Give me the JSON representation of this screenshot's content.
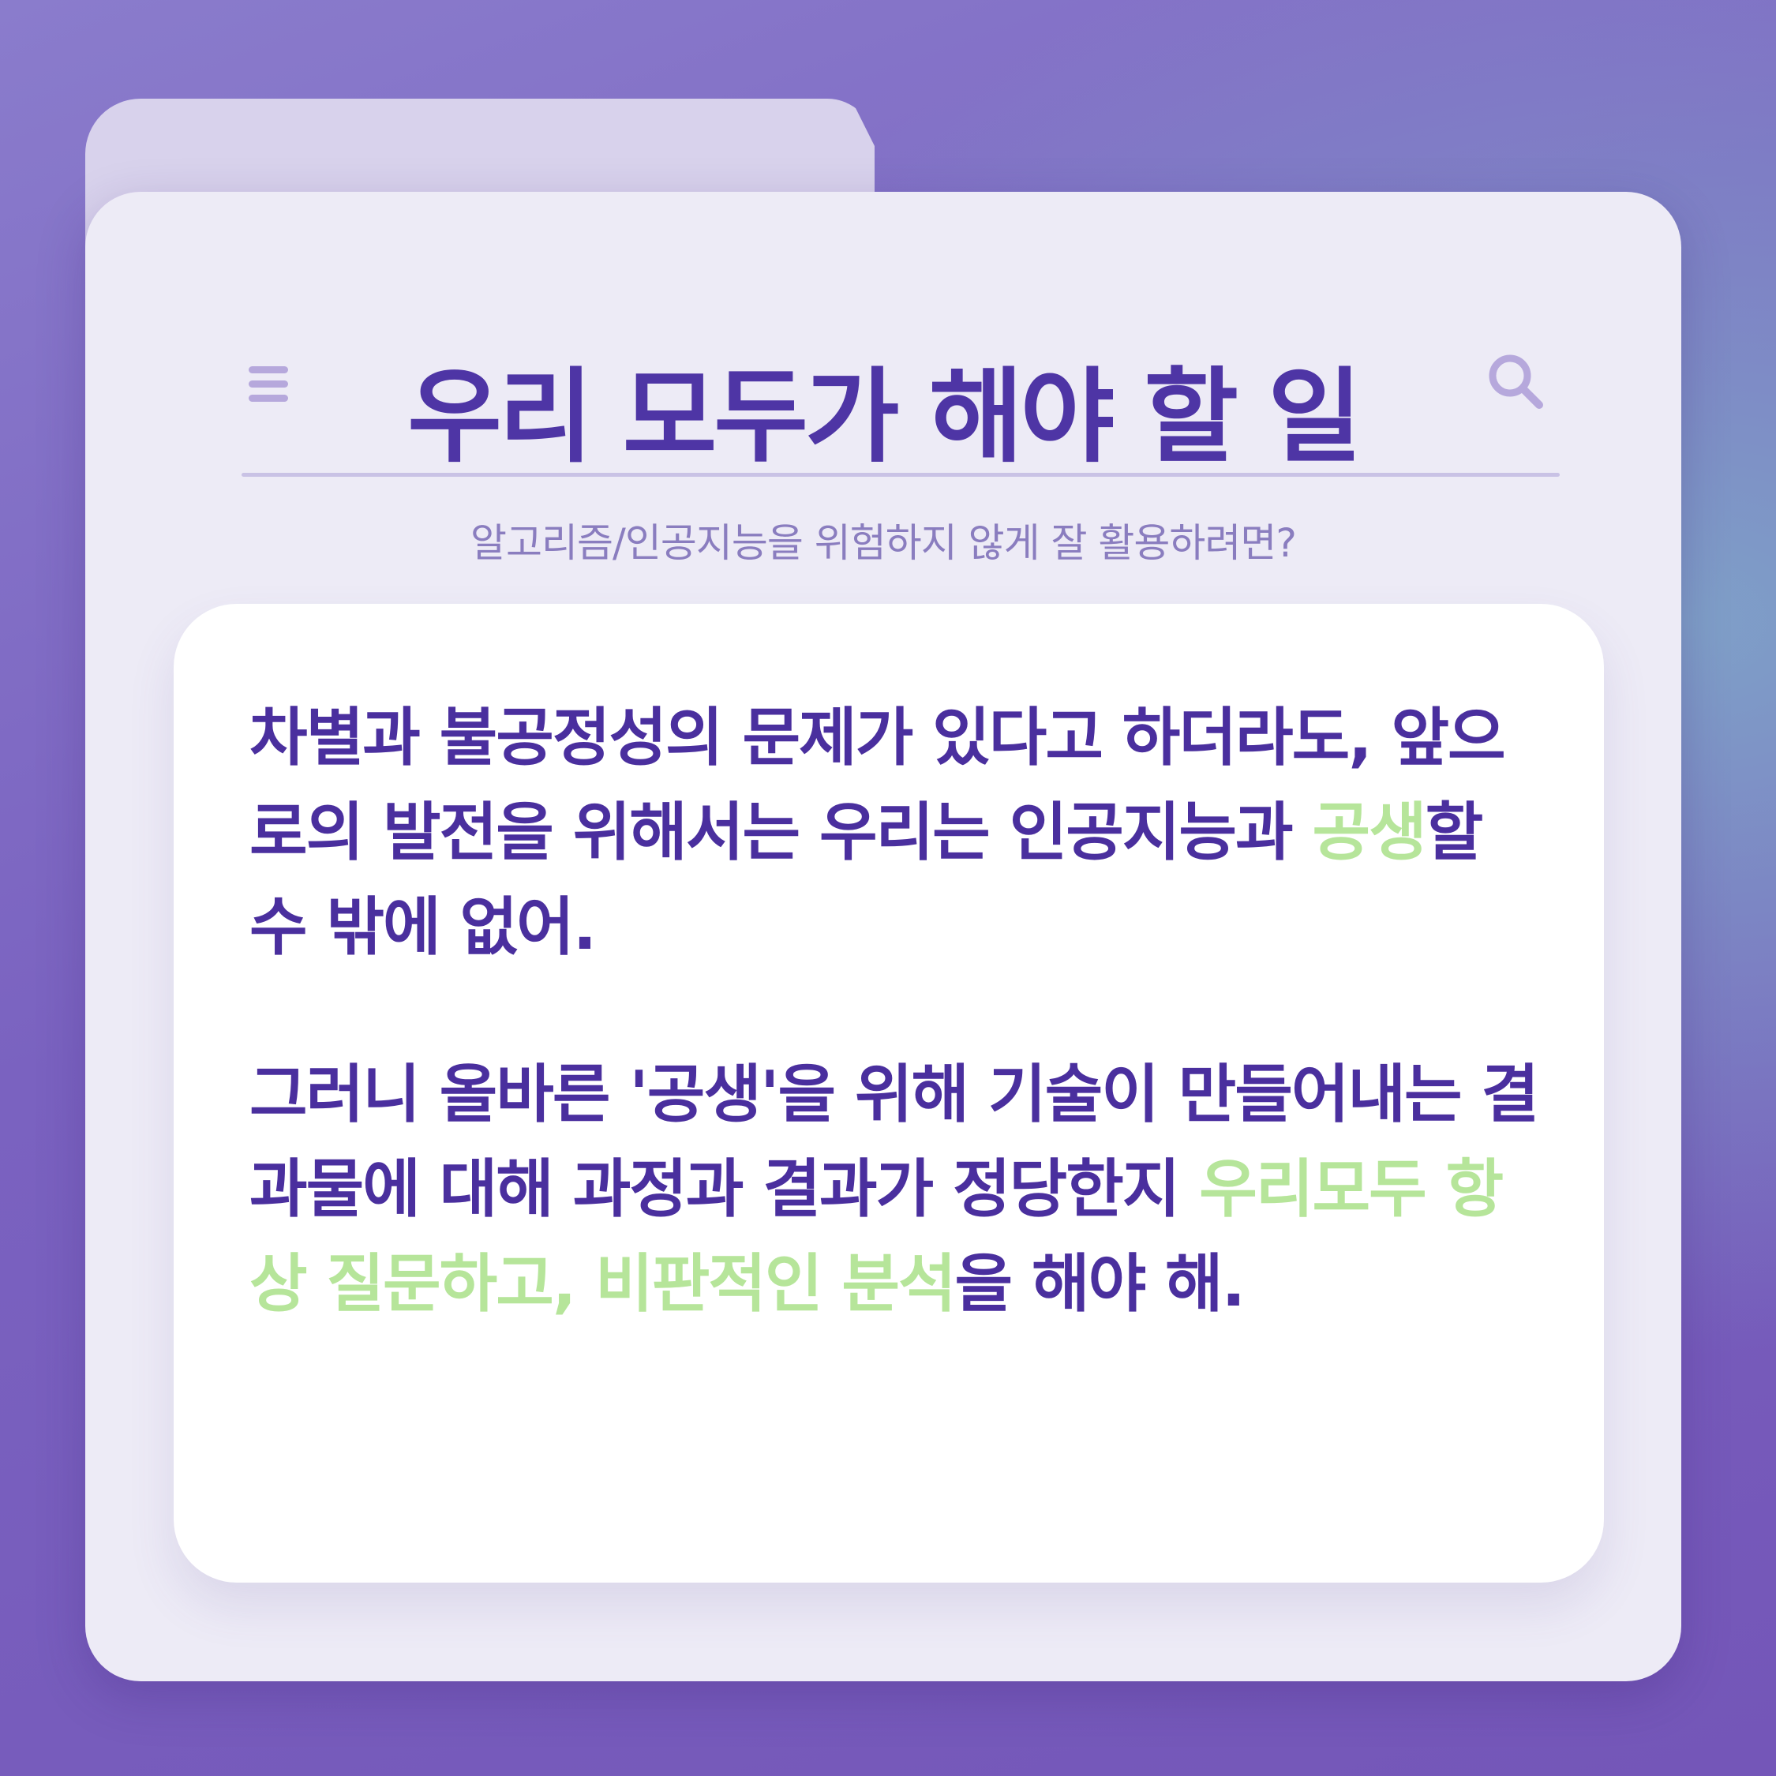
{
  "header": {
    "title": "우리 모두가 해야 할 일",
    "subtitle": "알고리즘/인공지능을 위험하지 않게 잘 활용하려면?"
  },
  "icons": {
    "menu": "hamburger-menu-icon",
    "search": "search-icon"
  },
  "colors": {
    "background": "#7a62c0",
    "folder": "#edebf6",
    "title": "#4e35a5",
    "text": "#4a2f9e",
    "highlight": "#b6e59a",
    "subtitle": "#8a7dbf"
  },
  "body": {
    "p1": {
      "before": "차별과 불공정성의 문제가 있다고 하더라도, 앞으로의 발전을 위해서는 우리는 인공지능과 ",
      "highlight": "공생",
      "after": "할 수 밖에 없어."
    },
    "p2": {
      "before": "그러니 올바른 '공생'을 위해 기술이 만들어내는 결과물에 대해 과정과 결과가 정당한지 ",
      "highlight": "우리모두 항상 질문하고, 비판적인 분석",
      "after": "을 해야 해."
    }
  }
}
